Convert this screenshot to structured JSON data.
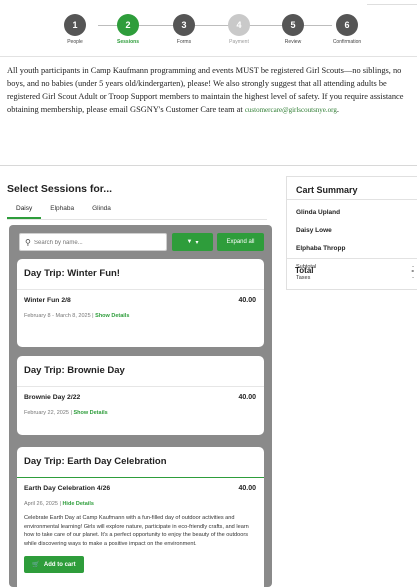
{
  "steps": [
    {
      "num": "1",
      "label": "People",
      "state": "done"
    },
    {
      "num": "2",
      "label": "Sessions",
      "state": "active"
    },
    {
      "num": "3",
      "label": "Forms",
      "state": "done"
    },
    {
      "num": "4",
      "label": "Payment",
      "state": "todo"
    },
    {
      "num": "5",
      "label": "Review",
      "state": "done"
    },
    {
      "num": "6",
      "label": "Confirmation",
      "state": "done"
    }
  ],
  "notice": {
    "text": "All youth participants in Camp Kaufmann programming and events MUST be registered Girl Scouts—no siblings, no boys, and no babies (under 5 years old/kindergarten), please! We also strongly suggest that all attending adults be registered Girl Scout Adult or Troop Support members to maintain the highest level of safety. If you require assistance obtaining membership, please email GSGNY's Customer Care team at ",
    "email": "customercare@girlscoutsnye.org",
    "end": "."
  },
  "sessions": {
    "title": "Select Sessions for...",
    "tabs": [
      "Daisy",
      "Elphaba",
      "Glinda"
    ],
    "active_tab": "Daisy",
    "search_placeholder": "Search by name...",
    "filter_label": "▼",
    "expand_label": "Expand all",
    "cards": [
      {
        "title": "Day Trip: Winter Fun!",
        "name": "Winter Fun 2/8",
        "price": "40.00",
        "date": "February 8 - March 8, 2025",
        "details": "Show Details"
      },
      {
        "title": "Day Trip: Brownie Day",
        "name": "Brownie Day 2/22",
        "price": "40.00",
        "date": "February 22, 2025",
        "details": "Show Details"
      },
      {
        "title": "Day Trip: Earth Day Celebration",
        "name": "Earth Day Celebration 4/26",
        "price": "40.00",
        "date": "April 26, 2025",
        "details": "Hide Details",
        "description": "Celebrate Earth Day at Camp Kaufmann with a fun-filled day of outdoor activities and environmental learning! Girls will explore nature, participate in eco-friendly crafts, and learn how to take care of our planet. It's a perfect opportunity to enjoy the beauty of the outdoors while discovering ways to make a positive impact on the environment.",
        "cart_label": "Add to cart"
      }
    ]
  },
  "cart": {
    "title": "Cart Summary",
    "people": [
      "Glinda Upland",
      "Daisy Lowe",
      "Elphaba Thropp"
    ],
    "subtotal_label": "Subtotal",
    "subtotal_value": "-",
    "taxes_label": "Taxes",
    "taxes_value": "-",
    "total_label": "Total",
    "total_value": "-"
  },
  "colors": {
    "accent": "#2e9d3b",
    "panel_bg": "#8a8a8a"
  }
}
